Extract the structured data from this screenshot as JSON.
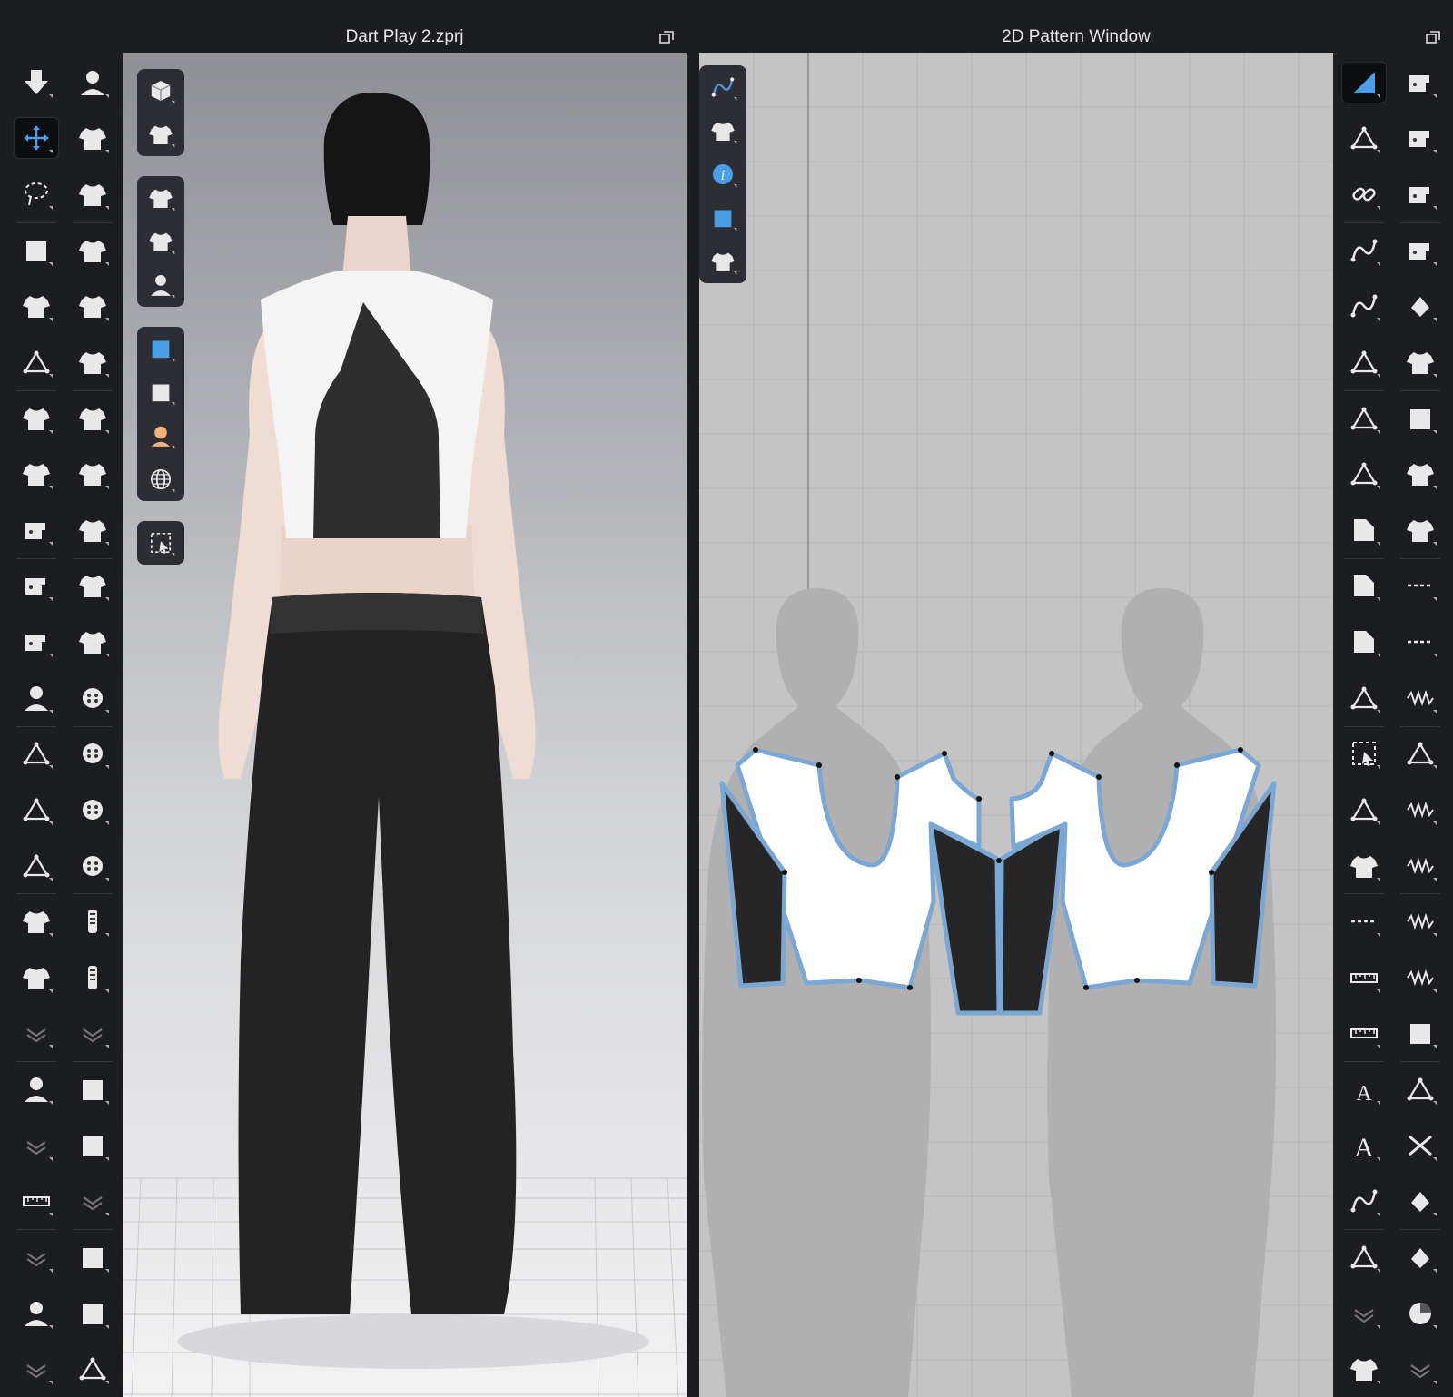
{
  "window3d": {
    "title": "Dart Play 2.zprj"
  },
  "window2d": {
    "title": "2D Pattern Window"
  },
  "colors": {
    "accent": "#4a9ee8",
    "pattern_outline": "#7aa7d4",
    "dark_fabric": "#262626",
    "light_fabric": "#ffffff",
    "panel_bg": "#1c1d21"
  },
  "left_tools_col1": [
    "arrow-down-icon",
    "move-select-icon",
    "lasso-select-icon",
    "box-select-icon",
    "fold-garment-icon",
    "fold-arrange-icon",
    "transform-garment-icon",
    "avatar-tshirt-icon",
    "sewing-machine-icon",
    "segment-sewing-icon",
    "free-sewing-icon",
    "pin-avatar-icon",
    "needle-icon",
    "tack-icon",
    "fitting-suit-icon",
    "garment-pack-icon",
    "shirt-stack-icon",
    "collapse-chevron-icon",
    "avatar-measure-icon",
    "collapse-chevron-icon",
    "tape-measure-icon",
    "collapse-chevron-icon",
    "avatar-size-icon",
    "collapse-chevron-icon"
  ],
  "left_tools_col2": [
    "walking-avatar-icon",
    "shirt-pin-icon",
    "shirt-pen-icon",
    "shirt-arrow-icon",
    "shirt-edit-icon",
    "shirt-cut-icon",
    "shirt-ribbon-icon",
    "shirt-lock-icon",
    "shirt-checker-icon",
    "shirt-checker-2-icon",
    "shirt-checker-3-icon",
    "button-cursor-icon",
    "button-icon",
    "buttonhole-icon",
    "lock-buttonhole-icon",
    "zipper-icon",
    "zipper-tab-icon",
    "collapse-chevron-icon",
    "box-fabric-icon",
    "fabric-roll-icon",
    "collapse-chevron-icon",
    "box-cut-icon",
    "fabric-square-icon",
    "puller-icon"
  ],
  "float3d": [
    [
      "cube-icon",
      "shirt-texture-icon"
    ],
    [
      "tshirt-icon",
      "tshirt-settings-icon",
      "avatar-icon"
    ],
    [
      "fabric-blue-icon",
      "fabric-dark-icon",
      "avatar-face-icon",
      "globe-icon"
    ],
    [
      "select-screen-icon"
    ]
  ],
  "float2d": [
    "pen-curve-icon",
    "tshirt-icon",
    "info-icon",
    "fabric-blue-icon",
    "tshirt-lock-icon"
  ],
  "right_tools_col1": [
    "edit-pattern-icon",
    "edit-point-icon",
    "link-icon",
    "curve-point-icon",
    "curve-icon",
    "add-point-icon",
    "cross-icon",
    "angle-icon",
    "triangle-arrow-icon",
    "pattern-shape-icon",
    "pattern-shape-2-icon",
    "ribbon-icon",
    "rect-select-icon",
    "gear-pin-icon",
    "shirt-outline-icon",
    "baseline-icon",
    "vertical-measure-icon",
    "ruler-icon",
    "text-a-icon",
    "text-a-large-icon",
    "curve-measure-icon",
    "grid-lines-icon",
    "collapse-chevron-icon",
    "shirt-fold-icon"
  ],
  "right_tools_col2": [
    "sewing-icon",
    "sewing-2-icon",
    "sewing-3-icon",
    "sewing-4-icon",
    "iron-icon",
    "tshirt-icon",
    "fabric-stack-icon",
    "checker-shirt-icon",
    "checker-shirt-2-icon",
    "dashed-line-icon",
    "dashed-line-2-icon",
    "wave-line-icon",
    "stitch-icon",
    "coil-icon",
    "zigzag-icon",
    "zigzag-2-icon",
    "zigzag-3-icon",
    "add-fabric-icon",
    "gift-icon",
    "scissors-icon",
    "paint-bucket-icon",
    "brush-icon",
    "pie-icon",
    "collapse-chevron-icon"
  ]
}
